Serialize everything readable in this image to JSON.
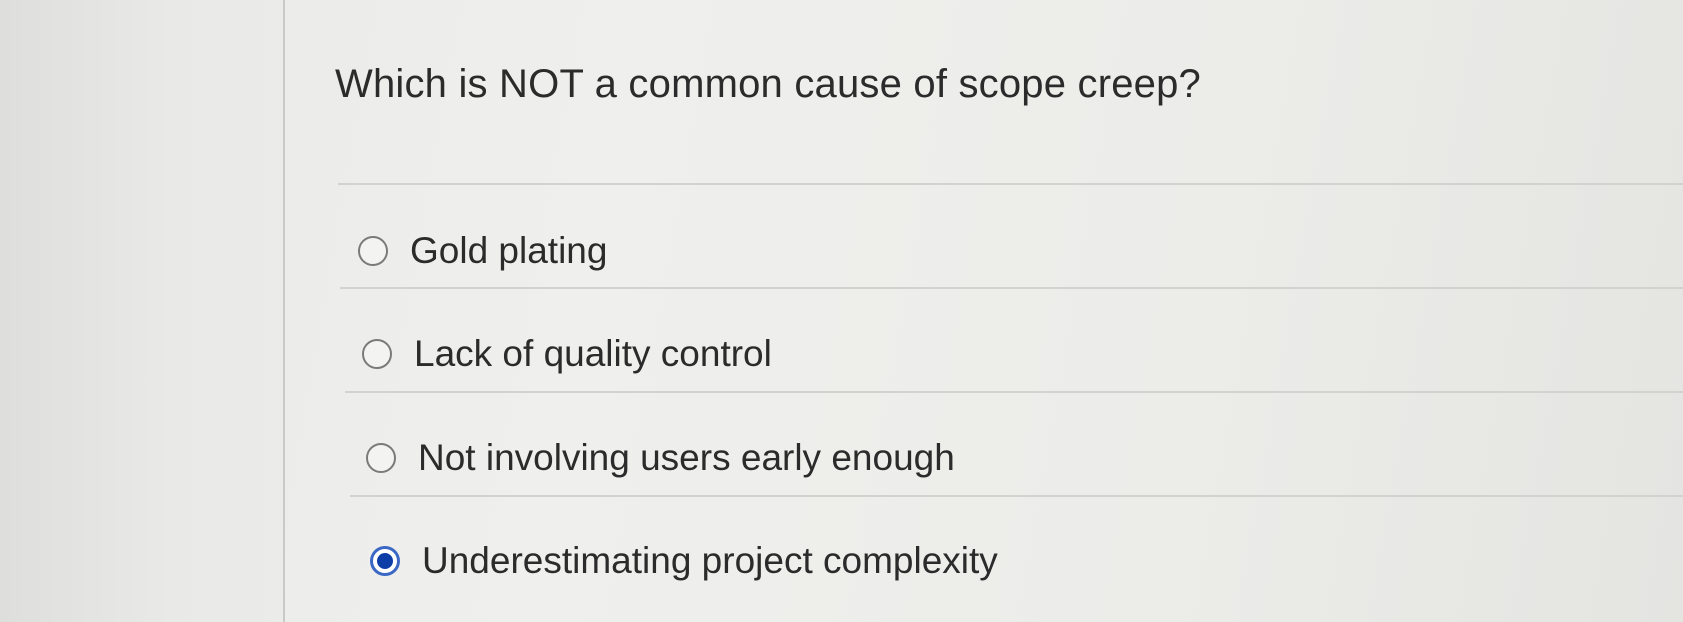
{
  "question": {
    "text": "Which is NOT a common cause of scope creep?"
  },
  "options": [
    {
      "label": "Gold plating",
      "selected": false
    },
    {
      "label": "Lack of quality control",
      "selected": false
    },
    {
      "label": "Not involving users early enough",
      "selected": false
    },
    {
      "label": "Underestimating project complexity",
      "selected": true
    }
  ],
  "colors": {
    "selected_radio": "#0d3ea8",
    "text": "#2b2b2b"
  }
}
